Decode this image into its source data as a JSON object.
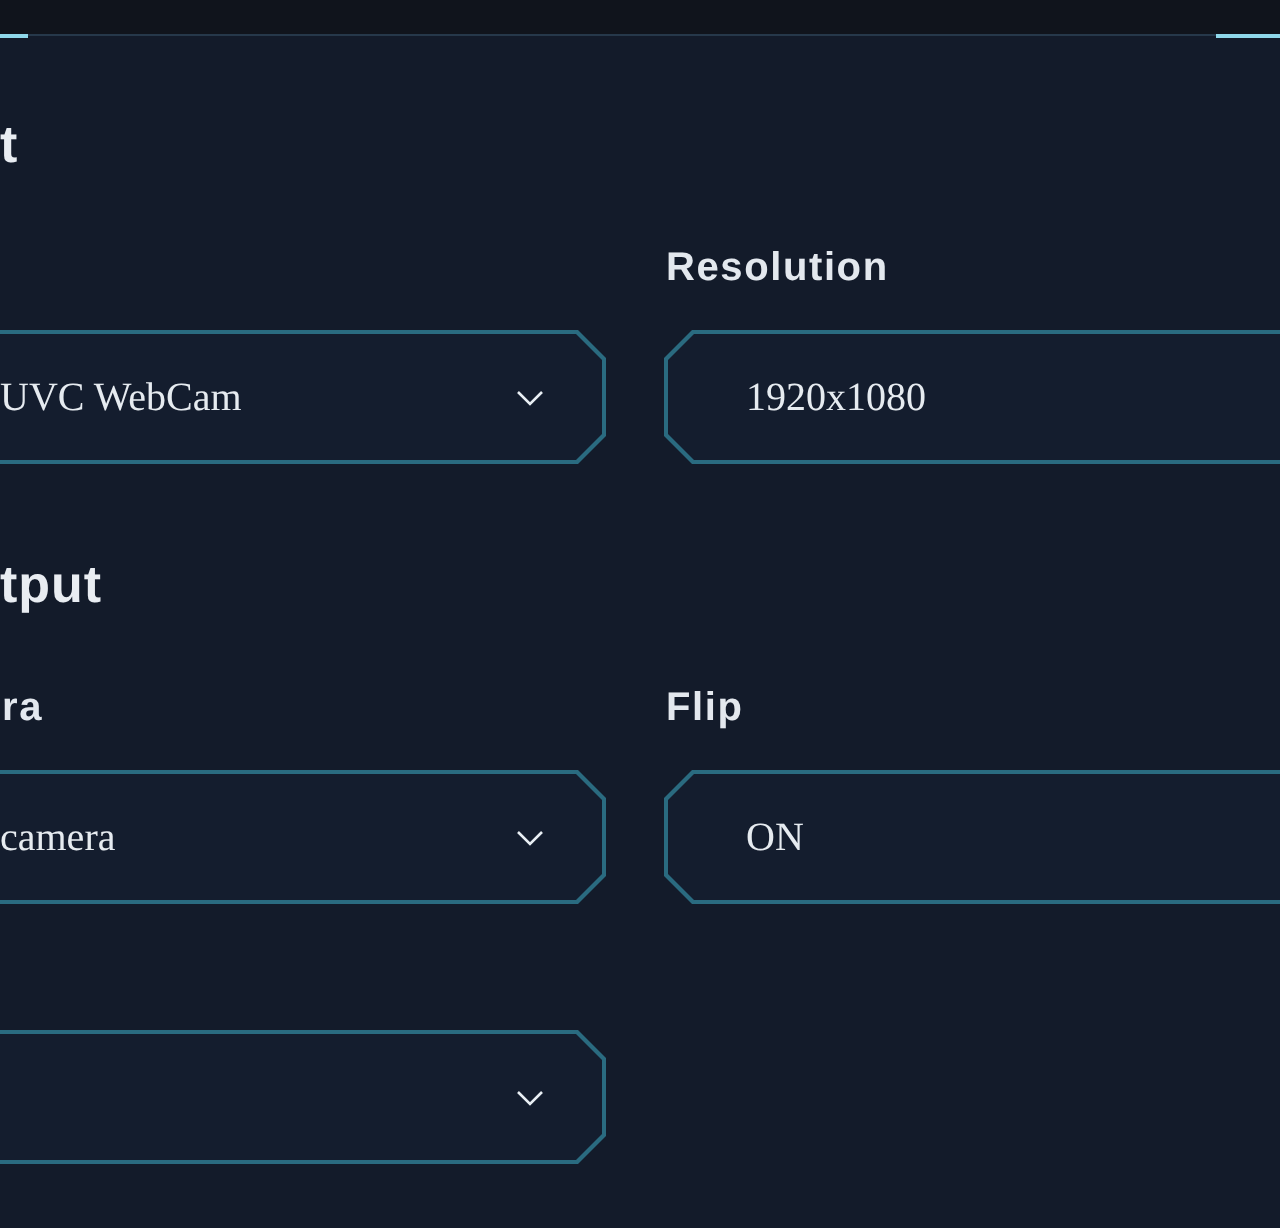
{
  "sections": [
    {
      "heading": "t",
      "fields": [
        {
          "kind": "select",
          "value": "UVC WebCam"
        },
        {
          "kind": "input",
          "label": "Resolution",
          "value": "1920x1080"
        }
      ]
    },
    {
      "heading": "tput",
      "fields": [
        {
          "kind": "select",
          "label": "ra",
          "value": "camera"
        },
        {
          "kind": "input",
          "label": "Flip",
          "value": "ON"
        },
        {
          "kind": "select"
        }
      ]
    }
  ]
}
